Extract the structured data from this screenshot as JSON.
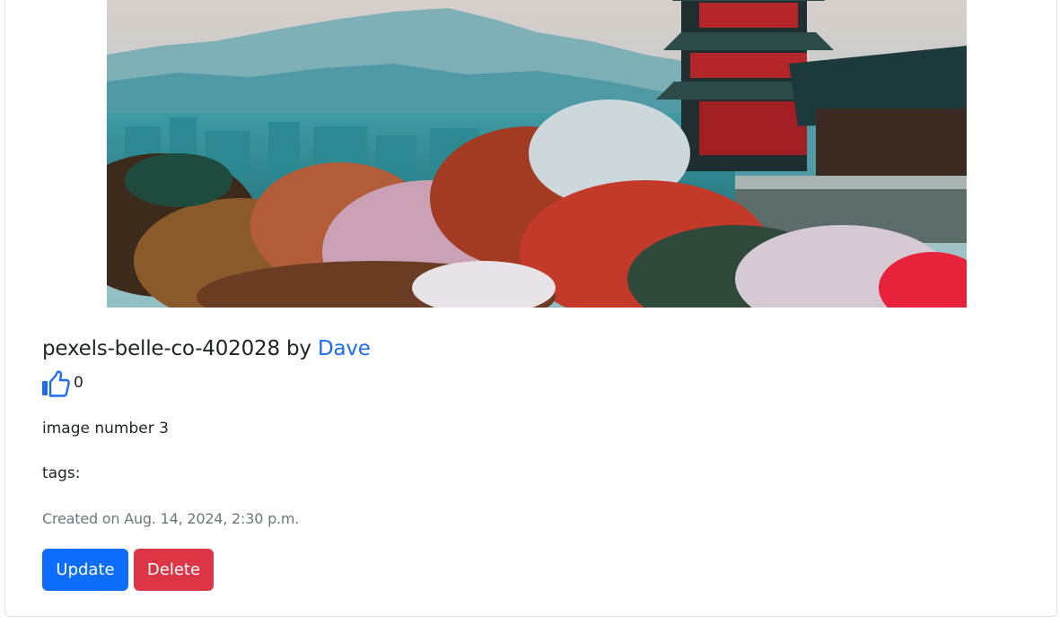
{
  "post": {
    "title": "pexels-belle-co-402028",
    "by": "by",
    "author": "Dave",
    "likes": "0",
    "description": "image number 3",
    "tags_label": "tags:",
    "created": "Created on Aug. 14, 2024, 2:30 p.m."
  },
  "actions": {
    "update_label": "Update",
    "delete_label": "Delete"
  },
  "icons": {
    "like": "thumbs-up-icon"
  },
  "colors": {
    "link": "#1f6bf0",
    "primary": "#0d6efd",
    "danger": "#dc3545",
    "muted": "#6c757d"
  }
}
